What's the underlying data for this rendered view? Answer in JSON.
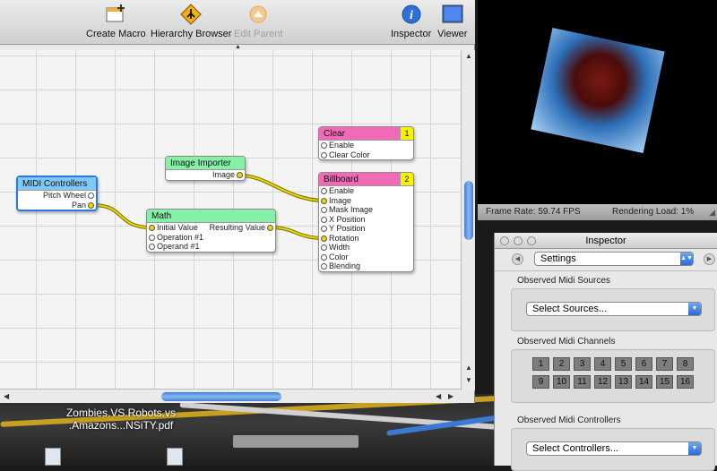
{
  "toolbar": {
    "create_macro": "Create Macro",
    "hierarchy_browser": "Hierarchy Browser",
    "edit_parent": "Edit Parent",
    "inspector": "Inspector",
    "viewer": "Viewer"
  },
  "patches": {
    "midi": {
      "title": "MIDI Controllers",
      "outputs": [
        "Pitch Wheel",
        "Pan"
      ]
    },
    "importer": {
      "title": "Image Importer",
      "outputs": [
        "Image"
      ]
    },
    "math": {
      "title": "Math",
      "inputs": [
        "Initial Value",
        "Operation #1",
        "Operand #1"
      ],
      "outputs": [
        "Resulting Value"
      ]
    },
    "clear": {
      "title": "Clear",
      "badge": "1",
      "inputs": [
        "Enable",
        "Clear Color"
      ]
    },
    "billboard": {
      "title": "Billboard",
      "badge": "2",
      "inputs": [
        "Enable",
        "Image",
        "Mask Image",
        "X Position",
        "Y Position",
        "Rotation",
        "Width",
        "Color",
        "Blending"
      ]
    }
  },
  "viewer": {
    "frame_rate": "Frame Rate:  59.74 FPS",
    "rendering_load": "Rendering Load:  1%"
  },
  "inspector": {
    "title": "Inspector",
    "mode": "Settings",
    "sources_label": "Observed Midi Sources",
    "sources_value": "Select Sources...",
    "channels_label": "Observed Midi Channels",
    "channels": [
      "1",
      "2",
      "3",
      "4",
      "5",
      "6",
      "7",
      "8",
      "9",
      "10",
      "11",
      "12",
      "13",
      "14",
      "15",
      "16"
    ],
    "controllers_label": "Observed Midi Controllers",
    "controllers_value": "Select Controllers..."
  },
  "desktop": {
    "file_label_line1": "Zombies.VS.Robots.vs",
    "file_label_line2": ".Amazons...NSiTY.pdf"
  },
  "colors": {
    "midi_title": "#7ec8f8",
    "importer_title": "#86f0a8",
    "math_title": "#86f0a8",
    "clear_title": "#f06ab8",
    "billboard_title": "#f06ab8",
    "badge": "#f7f300",
    "wire": "#d8c800",
    "scroll_thumb": "#3f7fd8"
  }
}
